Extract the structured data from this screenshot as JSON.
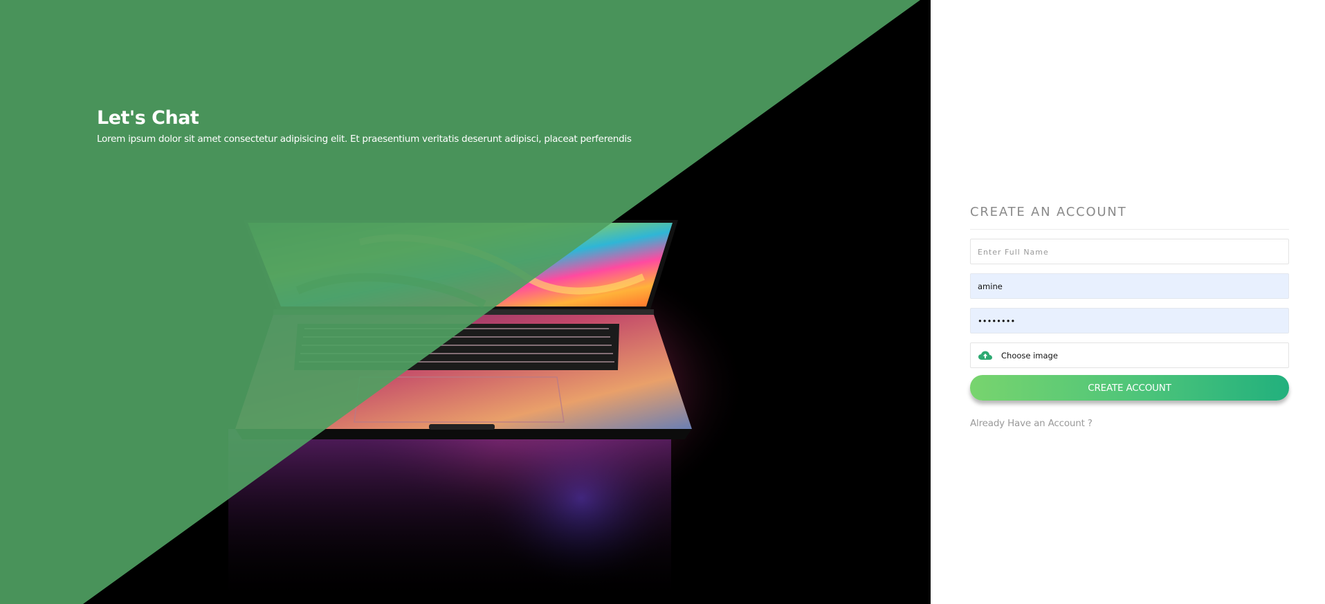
{
  "hero": {
    "title": "Let's Chat",
    "subtitle": "Lorem ipsum dolor sit amet consectetur adipisicing elit. Et praesentium veritatis deserunt adipisci, placeat perferendis",
    "overlay_color": "#4f9f62",
    "image_subject": "laptop-photo"
  },
  "form": {
    "title": "CREATE AN ACCOUNT",
    "fullname": {
      "placeholder": "Enter Full Name",
      "value": ""
    },
    "username": {
      "value": "amine"
    },
    "password": {
      "value": "password"
    },
    "file": {
      "icon": "cloud-upload-icon",
      "label": "Choose image"
    },
    "submit_label": "CREATE ACCOUNT",
    "login_link": "Already Have an Account ?"
  },
  "colors": {
    "accent_start": "#78d46e",
    "accent_end": "#22b07d",
    "autofill_bg": "#e8f0fe",
    "muted_text": "#9a9a9a"
  }
}
